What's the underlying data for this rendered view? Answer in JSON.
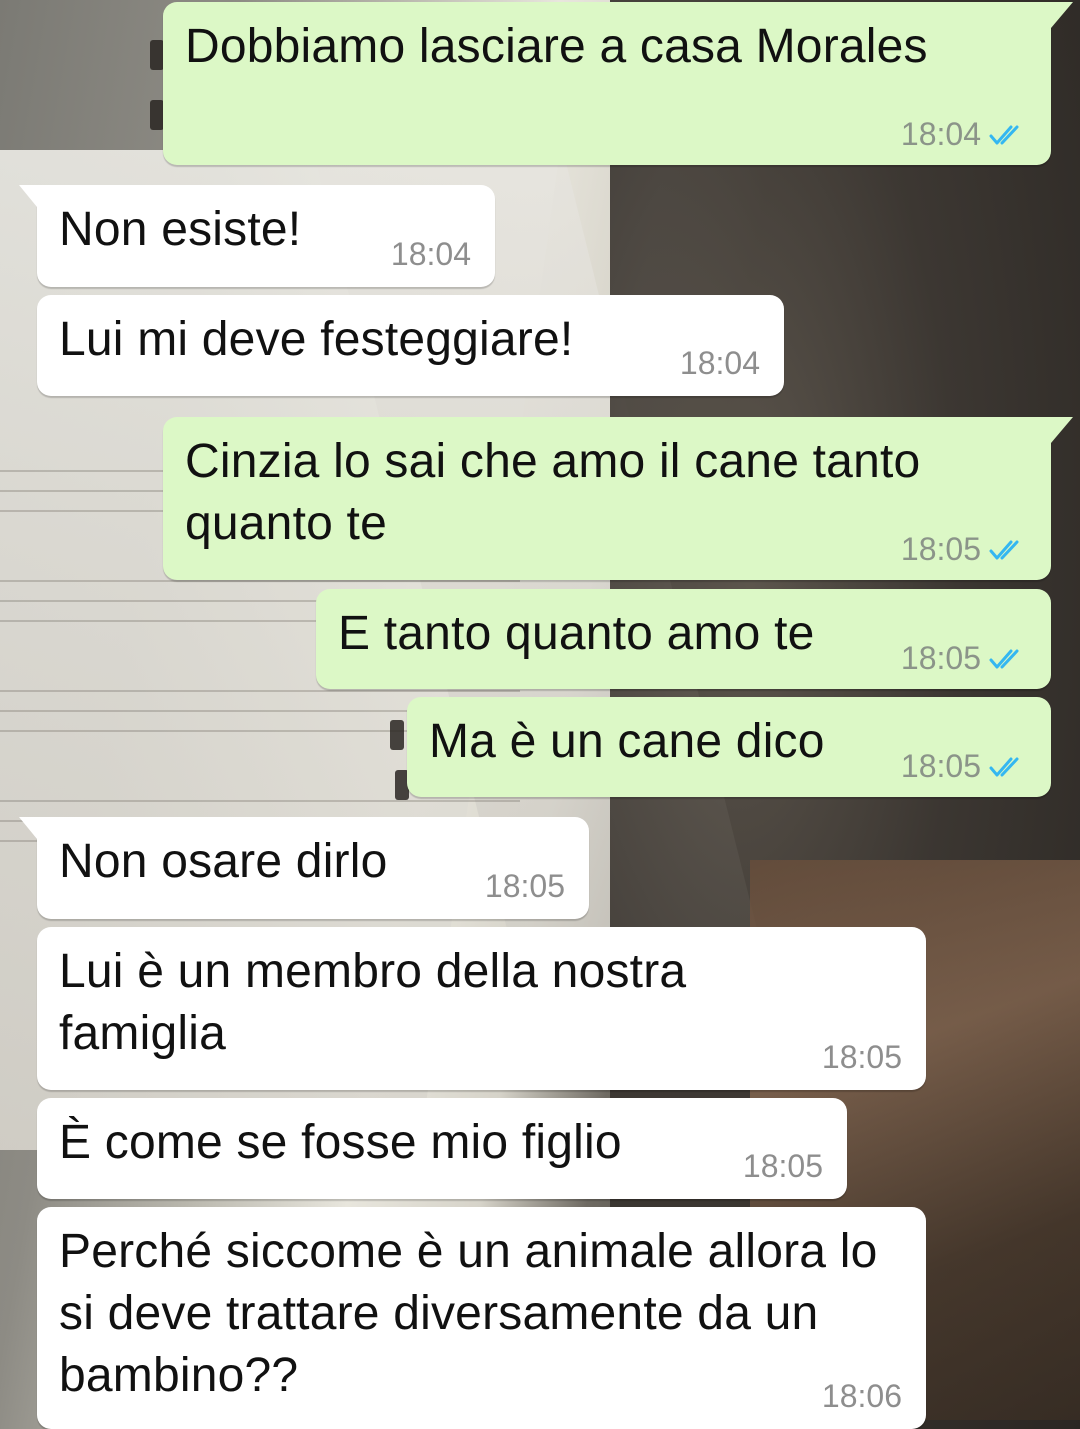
{
  "messages": [
    {
      "direction": "outgoing",
      "text": "Dobbiamo lasciare a casa Morales",
      "time": "18:04",
      "status_icon": "double-check-icon"
    },
    {
      "direction": "incoming",
      "text": "Non esiste!",
      "time": "18:04"
    },
    {
      "direction": "incoming",
      "text": "Lui mi deve festeggiare!",
      "time": "18:04"
    },
    {
      "direction": "outgoing",
      "text": "Cinzia lo sai che amo il cane tanto quanto te",
      "time": "18:05",
      "status_icon": "double-check-icon"
    },
    {
      "direction": "outgoing",
      "text": "E tanto quanto amo te",
      "time": "18:05",
      "status_icon": "double-check-icon"
    },
    {
      "direction": "outgoing",
      "text": "Ma è un cane dico",
      "time": "18:05",
      "status_icon": "double-check-icon"
    },
    {
      "direction": "incoming",
      "text": "Non osare dirlo",
      "time": "18:05"
    },
    {
      "direction": "incoming",
      "text": "Lui è un membro della nostra famiglia",
      "time": "18:05"
    },
    {
      "direction": "incoming",
      "text": "È come se fosse mio figlio",
      "time": "18:05"
    },
    {
      "direction": "incoming",
      "text": "Perché siccome è un animale allora lo si deve trattare diversamente da un bambino??",
      "time": "18:06"
    }
  ],
  "colors": {
    "outgoing_bubble": "#dcf8c6",
    "incoming_bubble": "#ffffff",
    "read_tick": "#34b7f1"
  }
}
